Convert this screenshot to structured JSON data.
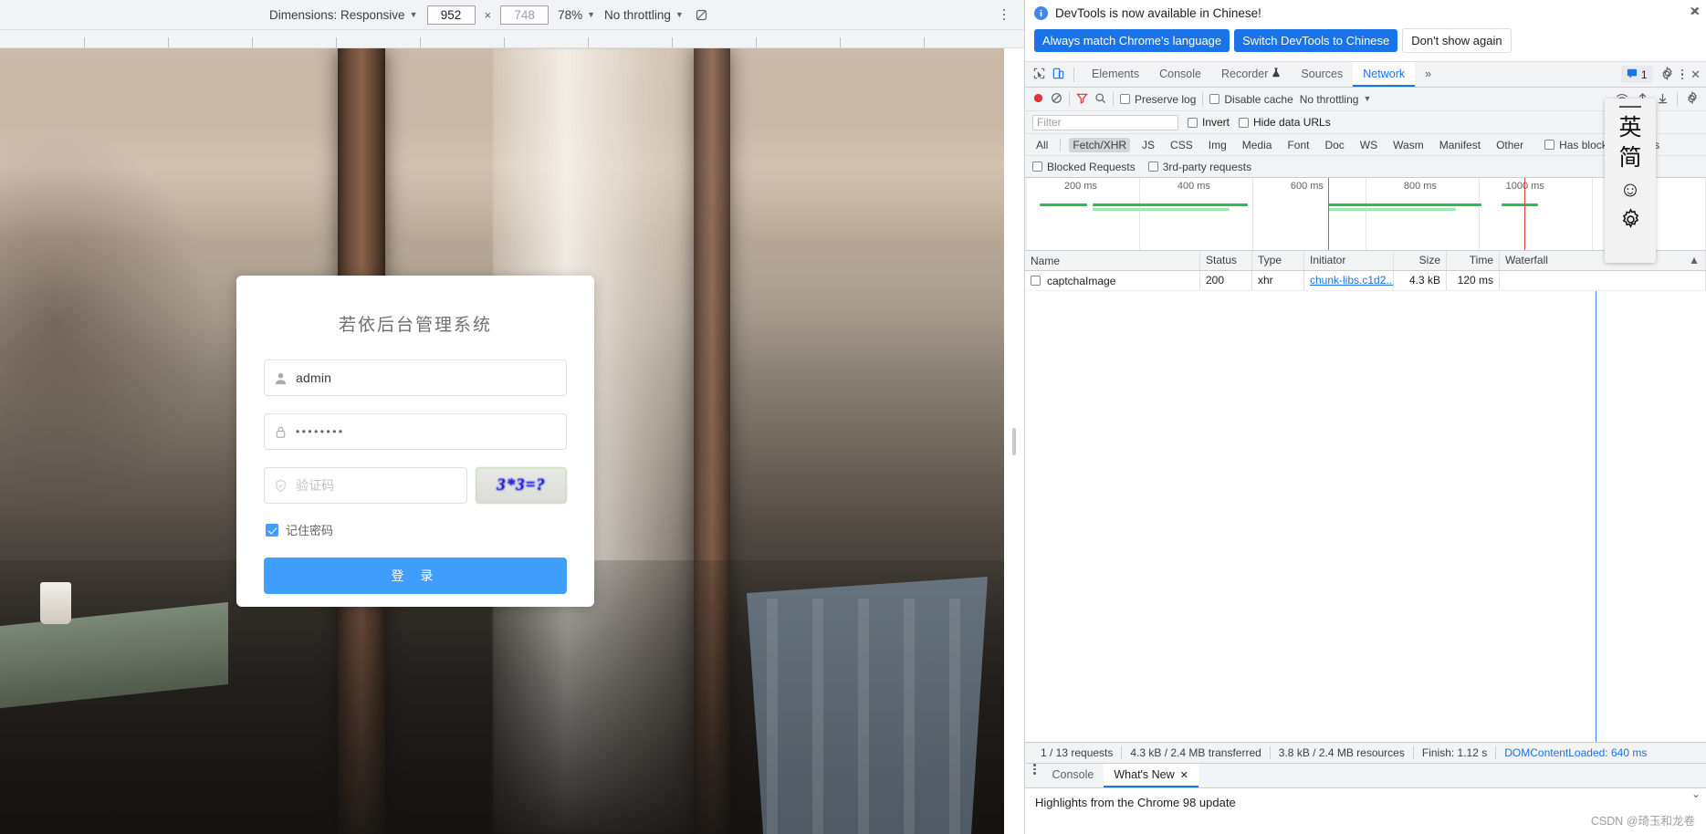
{
  "device_toolbar": {
    "dimensions_label": "Dimensions: Responsive",
    "width_value": "952",
    "height_value": "748",
    "zoom_value": "78%",
    "throttling_value": "No throttling",
    "rotate_icon": "rotate-icon",
    "kebab_icon": "more-options-icon"
  },
  "login": {
    "title": "若依后台管理系统",
    "username_value": "admin",
    "username_icon": "user-icon",
    "password_value": "••••••••",
    "password_icon": "lock-icon",
    "captcha_placeholder": "验证码",
    "captcha_icon": "shield-check-icon",
    "captcha_image_text": "3*3=?",
    "remember_label": "记住密码",
    "submit_label": "登 录"
  },
  "devtools": {
    "infobar": {
      "message": "DevTools is now available in Chinese!",
      "info_icon": "info-icon",
      "btn_always": "Always match Chrome's language",
      "btn_switch": "Switch DevTools to Chinese",
      "btn_dismiss": "Don't show again",
      "close_icon": "close-icon"
    },
    "tabs": [
      {
        "label": "Elements",
        "active": false
      },
      {
        "label": "Console",
        "active": false
      },
      {
        "label": "Recorder",
        "active": false,
        "badge": "flask-icon"
      },
      {
        "label": "Sources",
        "active": false
      },
      {
        "label": "Network",
        "active": true
      }
    ],
    "tab_overflow": "»",
    "inspect_icon": "inspect-element-icon",
    "device_toggle_icon": "device-toolbar-icon",
    "issues_count": "1",
    "issues_icon": "issues-message-icon",
    "settings_icon": "gear-icon",
    "more_icon": "more-options-icon",
    "close_icon": "close-icon",
    "network_toolbar": {
      "record_icon": "record-icon",
      "clear_icon": "clear-icon",
      "filter_icon": "filter-icon",
      "search_icon": "search-icon",
      "preserve_log": "Preserve log",
      "disable_cache": "Disable cache",
      "throttling": "No throttling",
      "wifi_icon": "network-conditions-icon",
      "import_icon": "import-har-icon",
      "export_icon": "export-har-icon",
      "settings_icon": "gear-icon"
    },
    "filter": {
      "placeholder": "Filter",
      "invert": "Invert",
      "hide_data_urls": "Hide data URLs",
      "types": [
        "All",
        "Fetch/XHR",
        "JS",
        "CSS",
        "Img",
        "Media",
        "Font",
        "Doc",
        "WS",
        "Wasm",
        "Manifest",
        "Other"
      ],
      "active_type": "Fetch/XHR",
      "has_blocked_cookies": "Has blocked cookies",
      "blocked_requests": "Blocked Requests",
      "third_party": "3rd-party requests"
    },
    "overview_ticks": [
      "200 ms",
      "400 ms",
      "600 ms",
      "800 ms",
      "1000 ms"
    ],
    "table": {
      "columns": [
        "Name",
        "Status",
        "Type",
        "Initiator",
        "Size",
        "Time",
        "Waterfall"
      ],
      "rows": [
        {
          "name": "captchaImage",
          "status": "200",
          "type": "xhr",
          "initiator": "chunk-libs.c1d2...",
          "size": "4.3 kB",
          "time": "120 ms",
          "waterfall": ""
        }
      ]
    },
    "status_bar": {
      "requests": "1 / 13 requests",
      "transferred": "4.3 kB / 2.4 MB transferred",
      "resources": "3.8 kB / 2.4 MB resources",
      "finish": "Finish: 1.12 s",
      "dom_content_loaded": "DOMContentLoaded: 640 ms"
    },
    "drawer": {
      "tabs": [
        {
          "label": "Console",
          "active": false
        },
        {
          "label": "What's New",
          "active": true,
          "closable": true
        }
      ],
      "content": "Highlights from the Chrome 98 update",
      "kebab_icon": "more-tools-icon",
      "close_icon": "close-icon"
    }
  },
  "ime_panel": {
    "items": [
      "英",
      "简"
    ],
    "emoji_icon": "smiley-icon",
    "settings_icon": "gear-icon",
    "handle_icon": "drag-handle-icon"
  },
  "watermark": "CSDN @琦玉和龙卷",
  "colors": {
    "accent_blue": "#1a73e8",
    "element_blue": "#409eff",
    "success_green": "#25c151",
    "red_marker": "#e04040"
  }
}
